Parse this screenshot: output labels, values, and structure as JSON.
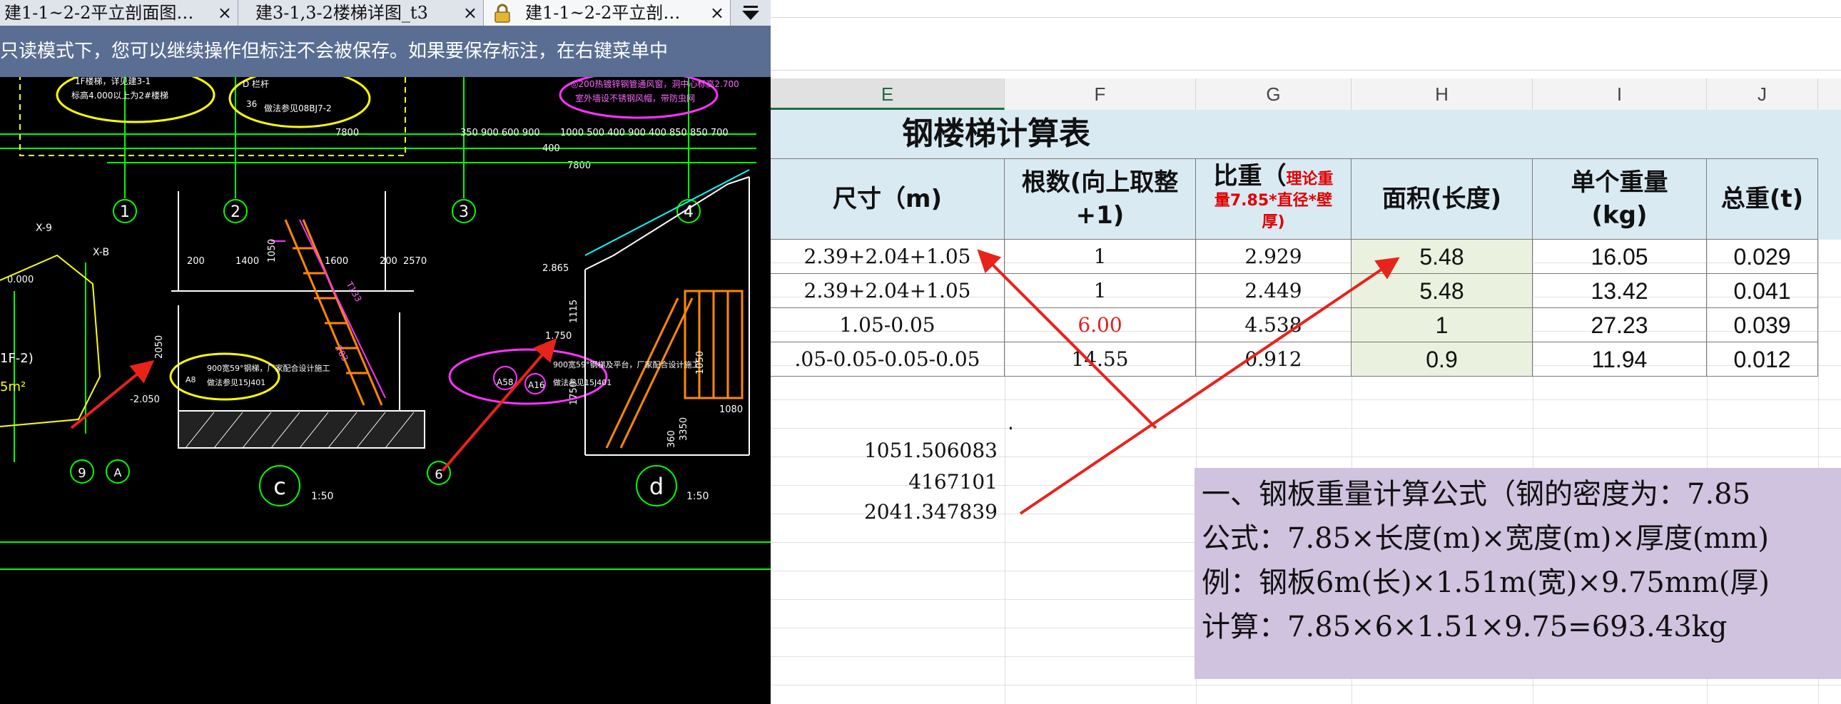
{
  "cad_window": {
    "tabs": [
      {
        "label": "建1-1~2-2平立剖面图…",
        "close": "×"
      },
      {
        "label": "建3-1,3-2楼梯详图_t3",
        "close": "×"
      },
      {
        "label": "建1-1~2-2平立剖…",
        "close": "×"
      }
    ],
    "readonly_notice": "只读模式下，您可以继续操作但标注不会被保存。如果要保存标注，在右键菜单中",
    "drawing_text": {
      "dims_top_row1": "350 900 600 900",
      "dims_top_row2": "1000 500 400 900 400 850 850 700",
      "dim_400": "400",
      "dim_7800_a": "7800",
      "dim_7800_b": "7800",
      "axis_1": "1",
      "axis_2": "2",
      "axis_3": "3",
      "axis_4": "4",
      "axis_9": "9",
      "axis_6": "6",
      "axis_A": "A",
      "section_c": "c",
      "section_d": "d",
      "scale_1": "1:50",
      "scale_2": "1:50",
      "elev_0000": "0.000",
      "elev_m2050": "-2.050",
      "elev_2865": "2.865",
      "elev_1750": "1.750",
      "dim_1050": "1050",
      "dim_2050": "2050",
      "dim_1115": "1115",
      "dim_1750": "1750",
      "dim_1080": "1080",
      "dim_200a": "200",
      "dim_1400": "1400",
      "dim_1600": "1600",
      "dim_200b": "200",
      "dim_2570": "2570",
      "note_top_left1": "1F楼梯，详见建3-1",
      "note_top_left2": "标高4.000以上为2#楼梯",
      "note_d36": "D 栏杆",
      "note_36": "36",
      "note_d36b": "做法参见08BJ7-2",
      "note_top_right1": "◎200热镀锌钢管通风窗，洞中心标高2.700",
      "note_top_right2": "室外墙设不锈钢风帽，带防虫网",
      "note_a8_1": "900宽59°钢梯，厂家配合设计施工",
      "note_a8_2": "做法参见15J401",
      "note_a8_label": "A8",
      "note_a58_1": "900宽59°钢梯及平台，厂家配合设计施工",
      "note_a58_2": "做法参见15J401",
      "label_a58": "A58",
      "label_a16": "A16",
      "label_x9": "X-9",
      "label_xb": "X-B",
      "label_1f2": "1F-2)",
      "label_5m2": "5m²",
      "label_t133": "T133",
      "label_t83": "T83",
      "label_3350": "3350",
      "label_360": "360"
    }
  },
  "spreadsheet": {
    "columns": [
      "E",
      "F",
      "G",
      "H",
      "I",
      "J"
    ],
    "title": "钢楼梯计算表",
    "headers": {
      "size": "尺寸（m)",
      "count_line1": "根数(向上取整",
      "count_line2": "+1)",
      "density_main": "比重（",
      "density_note1": "理论重",
      "density_note2": "量7.85*直径*壁",
      "density_note3": "厚)",
      "area": "面积(长度)",
      "unit_weight_line1": "单个重量",
      "unit_weight_line2": "(kg)",
      "total": "总重(t)"
    },
    "rows": [
      {
        "size": "2.39+2.04+1.05",
        "count": "1",
        "density": "2.929",
        "area": "5.48",
        "unit_weight": "16.05",
        "total": "0.029"
      },
      {
        "size": "2.39+2.04+1.05",
        "count": "1",
        "density": "2.449",
        "area": "5.48",
        "unit_weight": "13.42",
        "total": "0.041"
      },
      {
        "size": "1.05-0.05",
        "count": "6.00",
        "density": "4.538",
        "area": "1",
        "unit_weight": "27.23",
        "total": "0.039"
      },
      {
        "size": ".05-0.05-0.05-0.05",
        "count": "14.55",
        "density": "0.912",
        "area": "0.9",
        "unit_weight": "11.94",
        "total": "0.012"
      }
    ],
    "dot": ".",
    "extra_numbers": [
      "1051.506083",
      "4167101",
      "2041.347839"
    ],
    "formula_lines": [
      "一、钢板重量计算公式（钢的密度为：7.85",
      "公式：7.85×长度(m)×宽度(m)×厚度(mm)",
      "例：钢板6m(长)×1.51m(宽)×9.75mm(厚)",
      "计算：7.85×6×1.51×9.75=693.43kg"
    ]
  },
  "colors": {
    "cad_background": "#000000",
    "cad_line_yellow": "#ffff00",
    "cad_line_green": "#00ff00",
    "cad_line_magenta": "#ff33ff",
    "cad_line_white": "#ffffff",
    "cad_line_orange": "#ff8800",
    "annotation_arrow": "#e8231a",
    "sheet_header_fill": "#daeaf3",
    "area_column_fill": "#eaf1de",
    "formula_box_fill": "#cfc3df",
    "readonly_bar": "#5a6e93"
  }
}
